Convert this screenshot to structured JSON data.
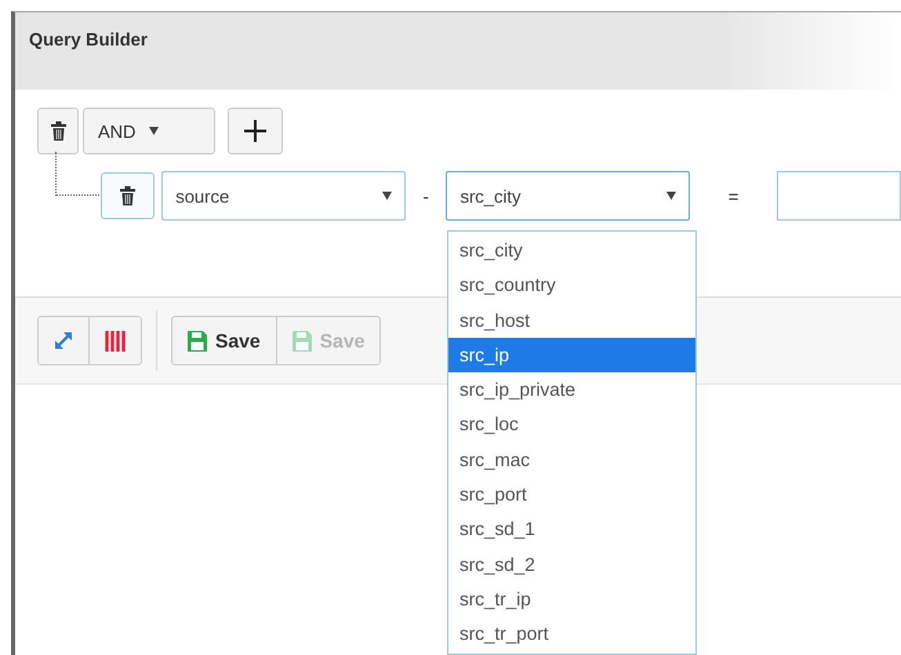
{
  "panel": {
    "title": "Query Builder"
  },
  "group": {
    "condition": "AND",
    "rules": [
      {
        "field": "source",
        "operator": "-",
        "subfield": "src_city",
        "comparator": "="
      }
    ]
  },
  "dropdown": {
    "options": [
      {
        "label": "src_city",
        "selected": false
      },
      {
        "label": "src_country",
        "selected": false
      },
      {
        "label": "src_host",
        "selected": false
      },
      {
        "label": "src_ip",
        "selected": true
      },
      {
        "label": "src_ip_private",
        "selected": false
      },
      {
        "label": "src_loc",
        "selected": false
      },
      {
        "label": "src_mac",
        "selected": false
      },
      {
        "label": "src_port",
        "selected": false
      },
      {
        "label": "src_sd_1",
        "selected": false
      },
      {
        "label": "src_sd_2",
        "selected": false
      },
      {
        "label": "src_tr_ip",
        "selected": false
      },
      {
        "label": "src_tr_port",
        "selected": false
      }
    ]
  },
  "toolbar": {
    "tools": [
      {
        "kind": "expand"
      },
      {
        "kind": "columns"
      }
    ],
    "save_buttons": [
      {
        "label": "Save",
        "disabled": false
      },
      {
        "label": "Save",
        "disabled": true
      }
    ]
  }
}
